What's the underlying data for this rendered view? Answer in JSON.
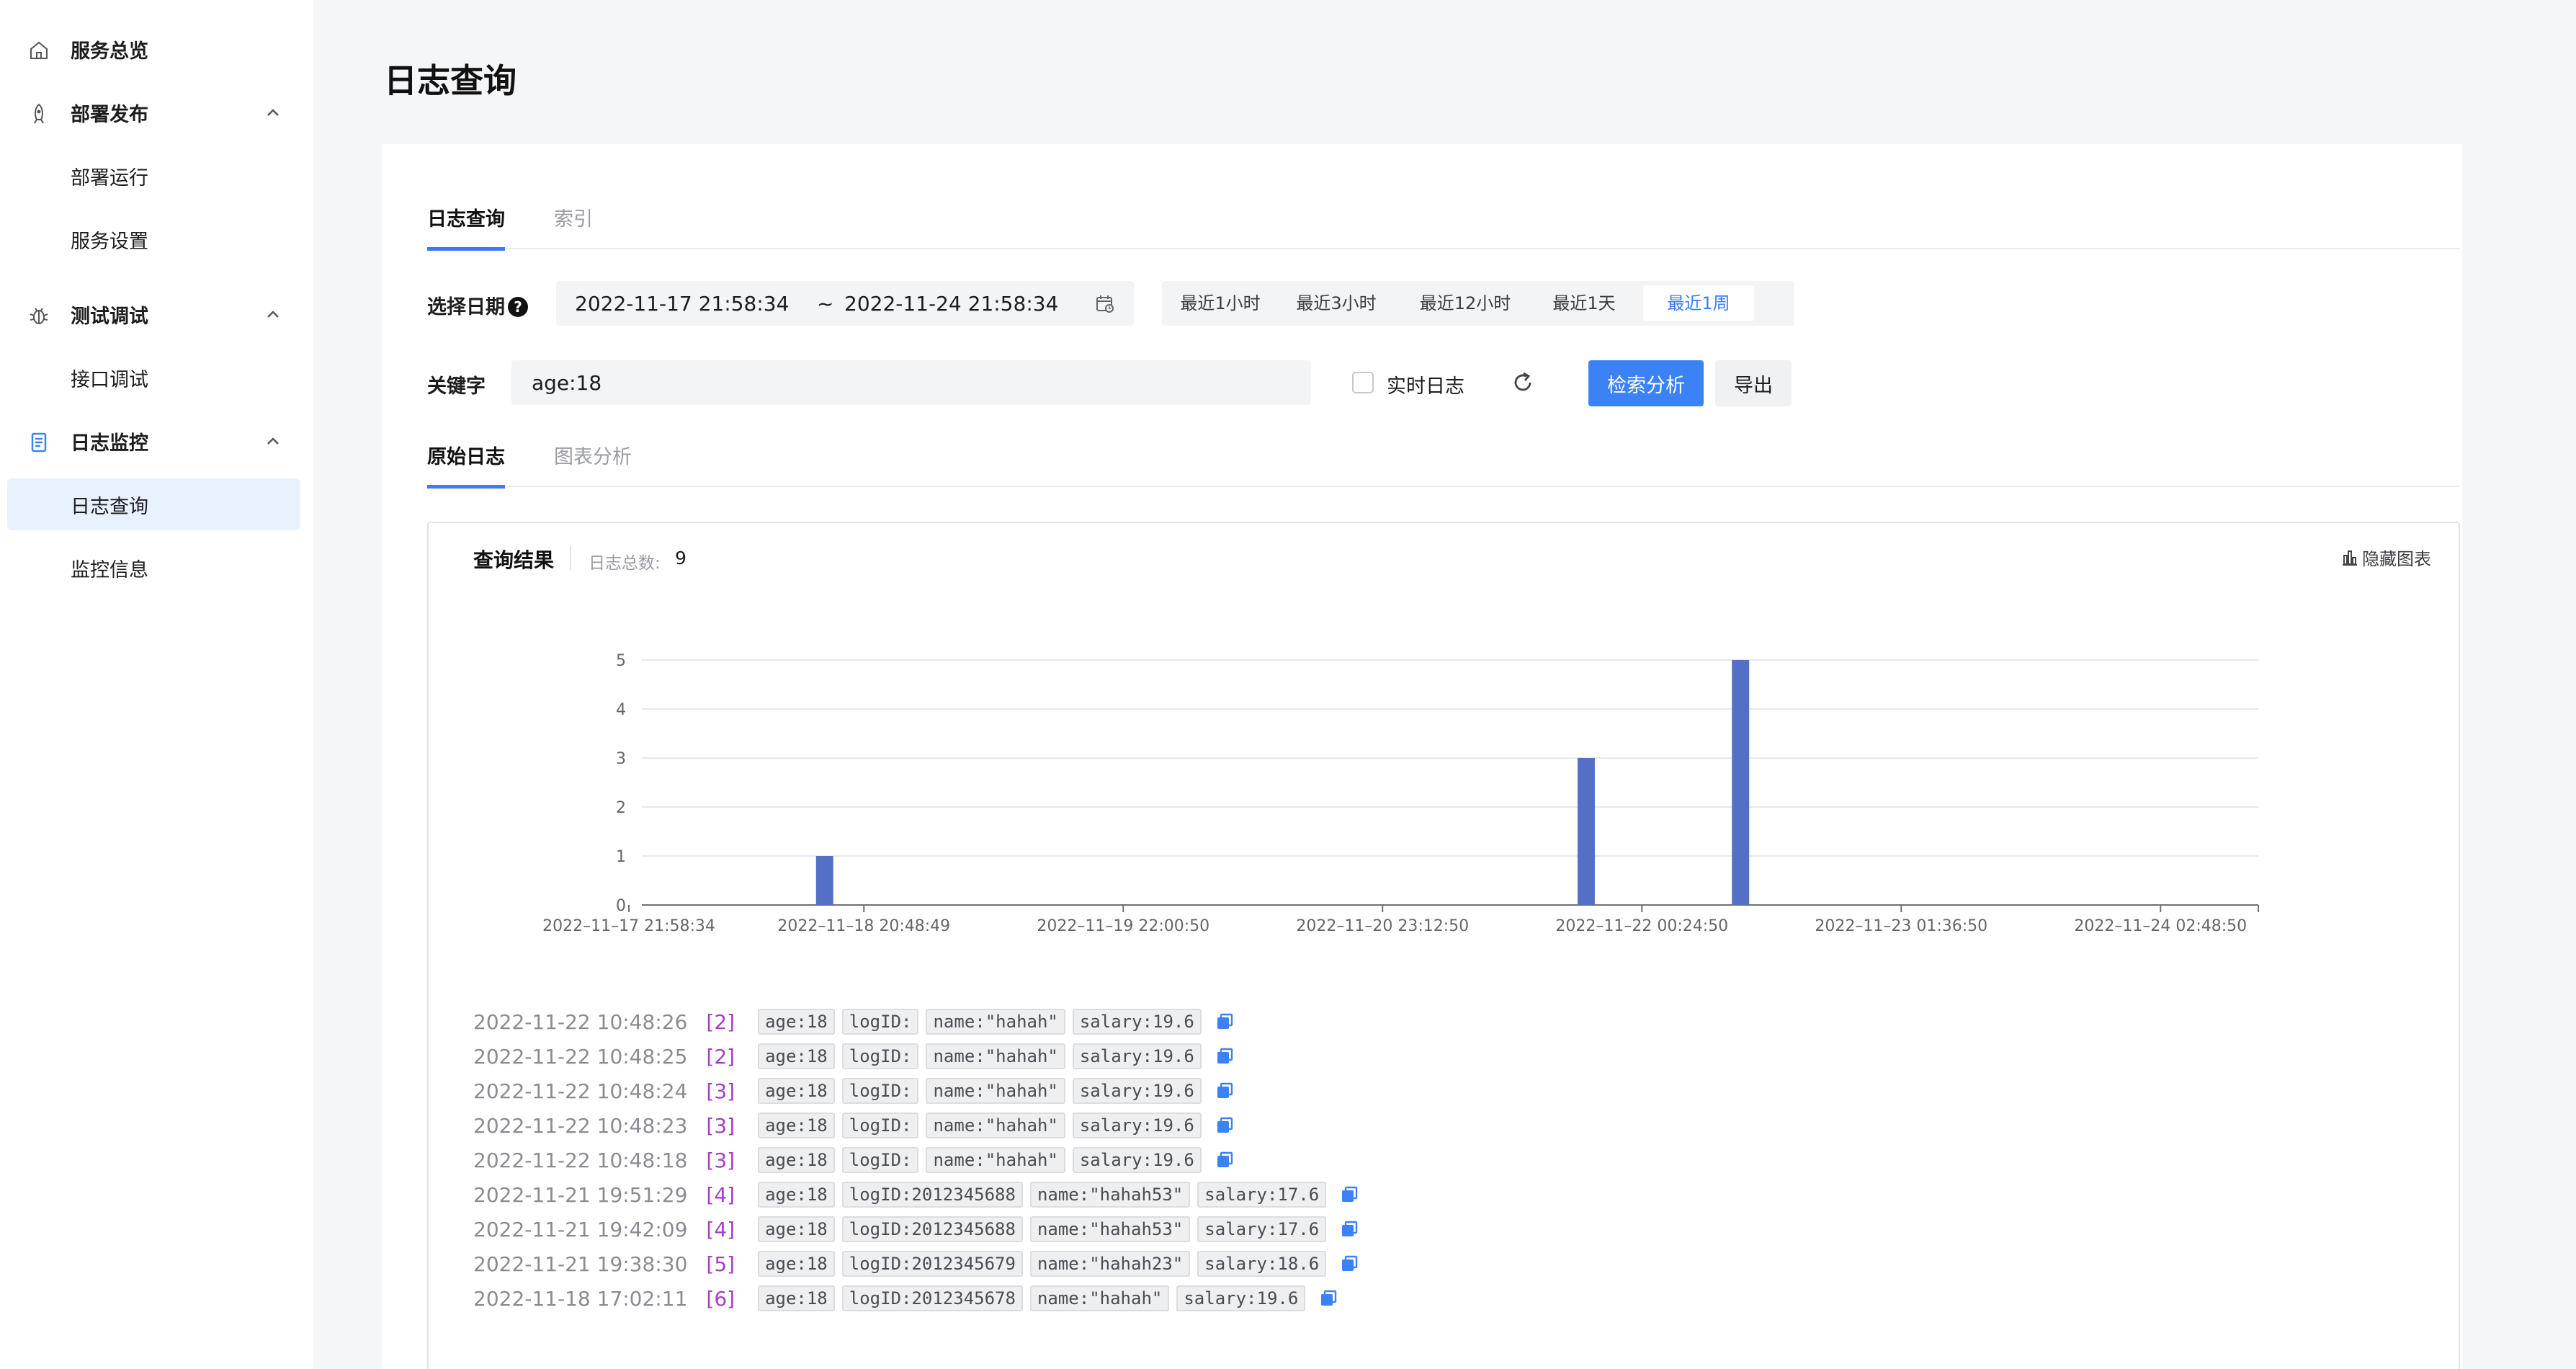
{
  "sidebar": {
    "items": [
      {
        "label": "服务总览",
        "icon": "home-icon",
        "type": "top"
      },
      {
        "label": "部署发布",
        "icon": "rocket-icon",
        "type": "group",
        "expanded": true
      },
      {
        "label": "部署运行",
        "type": "sub"
      },
      {
        "label": "服务设置",
        "type": "sub"
      },
      {
        "label": "测试调试",
        "icon": "bug-icon",
        "type": "group",
        "expanded": true
      },
      {
        "label": "接口调试",
        "type": "sub"
      },
      {
        "label": "日志监控",
        "icon": "log-icon",
        "type": "group",
        "expanded": true
      },
      {
        "label": "日志查询",
        "type": "sub",
        "active": true
      },
      {
        "label": "监控信息",
        "type": "sub"
      }
    ]
  },
  "page": {
    "title": "日志查询"
  },
  "main_tabs": [
    {
      "label": "日志查询",
      "active": true
    },
    {
      "label": "索引",
      "active": false
    }
  ],
  "filters": {
    "date_label": "选择日期",
    "help_glyph": "?",
    "date_start": "2022-11-17 21:58:34",
    "date_sep": "~",
    "date_end": "2022-11-24 21:58:34",
    "quick_ranges": [
      {
        "label": "最近1小时",
        "active": false
      },
      {
        "label": "最近3小时",
        "active": false
      },
      {
        "label": "最近12小时",
        "active": false
      },
      {
        "label": "最近1天",
        "active": false
      },
      {
        "label": "最近1周",
        "active": true
      }
    ],
    "keyword_label": "关键字",
    "keyword_value": "age:18",
    "realtime_label": "实时日志",
    "realtime_checked": false,
    "search_button": "检索分析",
    "export_button": "导出"
  },
  "sub_tabs": [
    {
      "label": "原始日志",
      "active": true
    },
    {
      "label": "图表分析",
      "active": false
    }
  ],
  "results": {
    "title": "查询结果",
    "count_label": "日志总数:",
    "count": "9",
    "hide_chart_label": "隐藏图表"
  },
  "chart_data": {
    "type": "bar",
    "x_ticks": [
      "2022-11-17 21:58:34",
      "2022-11-18 20:48:49",
      "2022-11-19 22:00:50",
      "2022-11-20 23:12:50",
      "2022-11-22 00:24:50",
      "2022-11-23 01:36:50",
      "2022-11-24 02:48:50"
    ],
    "y_ticks": [
      0,
      1,
      2,
      3,
      4,
      5
    ],
    "ylim": [
      0,
      5
    ],
    "bars": [
      {
        "x": "2022-11-18 17:00",
        "value": 1
      },
      {
        "x": "2022-11-21 19:00",
        "value": 3
      },
      {
        "x": "2022-11-22 10:00",
        "value": 5
      }
    ],
    "bar_color": "#5470c6",
    "grid": true
  },
  "logs": [
    {
      "time": "2022-11-22 10:48:26",
      "index": "[2]",
      "fields": [
        "age:18",
        "logID:",
        "name:\"hahah\"",
        "salary:19.6"
      ]
    },
    {
      "time": "2022-11-22 10:48:25",
      "index": "[2]",
      "fields": [
        "age:18",
        "logID:",
        "name:\"hahah\"",
        "salary:19.6"
      ]
    },
    {
      "time": "2022-11-22 10:48:24",
      "index": "[3]",
      "fields": [
        "age:18",
        "logID:",
        "name:\"hahah\"",
        "salary:19.6"
      ]
    },
    {
      "time": "2022-11-22 10:48:23",
      "index": "[3]",
      "fields": [
        "age:18",
        "logID:",
        "name:\"hahah\"",
        "salary:19.6"
      ]
    },
    {
      "time": "2022-11-22 10:48:18",
      "index": "[3]",
      "fields": [
        "age:18",
        "logID:",
        "name:\"hahah\"",
        "salary:19.6"
      ]
    },
    {
      "time": "2022-11-21 19:51:29",
      "index": "[4]",
      "fields": [
        "age:18",
        "logID:2012345688",
        "name:\"hahah53\"",
        "salary:17.6"
      ]
    },
    {
      "time": "2022-11-21 19:42:09",
      "index": "[4]",
      "fields": [
        "age:18",
        "logID:2012345688",
        "name:\"hahah53\"",
        "salary:17.6"
      ]
    },
    {
      "time": "2022-11-21 19:38:30",
      "index": "[5]",
      "fields": [
        "age:18",
        "logID:2012345679",
        "name:\"hahah23\"",
        "salary:18.6"
      ]
    },
    {
      "time": "2022-11-18 17:02:11",
      "index": "[6]",
      "fields": [
        "age:18",
        "logID:2012345678",
        "name:\"hahah\"",
        "salary:19.6"
      ]
    }
  ],
  "colors": {
    "accent": "#3b82f6",
    "index_purple": "#a43fc4",
    "bar": "#5470c6"
  }
}
